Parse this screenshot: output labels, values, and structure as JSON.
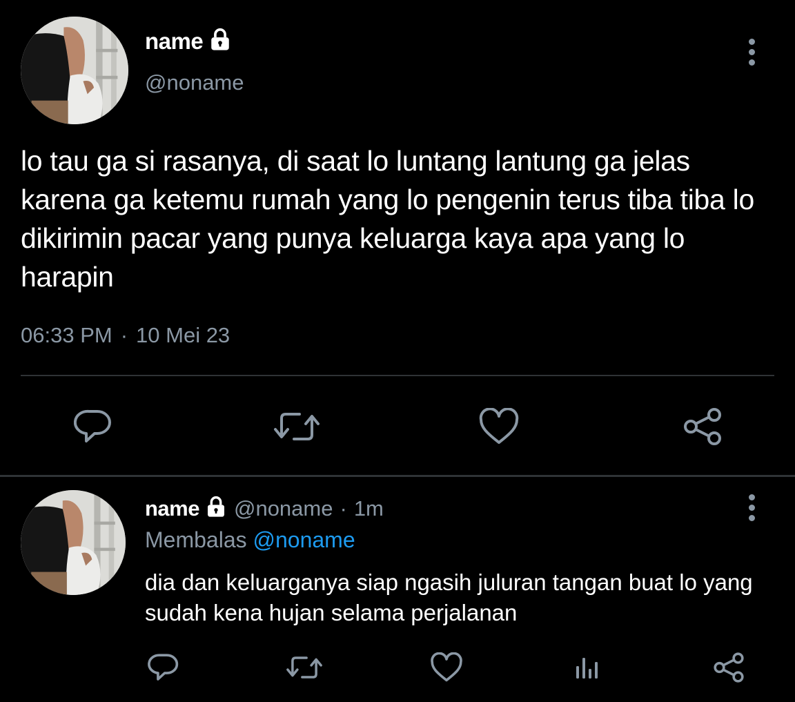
{
  "main_tweet": {
    "display_name": "name",
    "handle": "@noname",
    "text": "lo tau ga si rasanya, di saat lo luntang lantung ga jelas karena ga ketemu rumah yang lo pengenin terus tiba tiba lo dikirimin pacar yang punya keluarga kaya apa yang lo harapin",
    "time": "06:33 PM",
    "separator": "·",
    "date": "10 Mei 23",
    "actions": [
      "reply-icon",
      "retweet-icon",
      "like-icon",
      "share-icon"
    ]
  },
  "reply_tweet": {
    "display_name": "name",
    "handle": "@noname",
    "separator": "·",
    "time": "1m",
    "replying_label": "Membalas",
    "replying_to": "@noname",
    "text": "dia dan keluarganya siap ngasih juluran tangan buat lo yang sudah kena hujan selama perjalanan",
    "actions": [
      "reply-icon",
      "retweet-icon",
      "like-icon",
      "analytics-icon",
      "share-icon"
    ]
  },
  "colors": {
    "background": "#000000",
    "text_primary": "#ffffff",
    "text_secondary": "#8b98a5",
    "link": "#1d9bf0",
    "divider": "#2f3336"
  }
}
